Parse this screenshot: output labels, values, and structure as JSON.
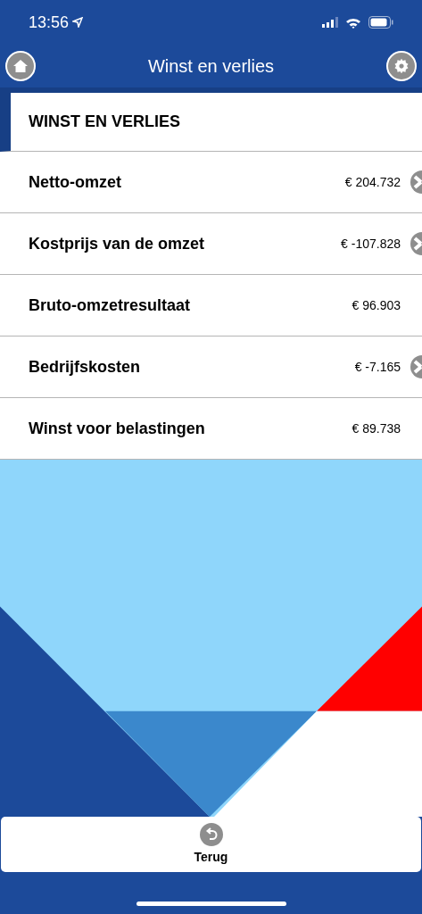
{
  "status_bar": {
    "time": "13:56"
  },
  "nav_bar": {
    "title": "Winst en verlies"
  },
  "section": {
    "title": "WINST EN VERLIES"
  },
  "rows": [
    {
      "label": "Netto-omzet",
      "value": "€ 204.732",
      "has_detail": true
    },
    {
      "label": "Kostprijs van de omzet",
      "value": "€ -107.828",
      "has_detail": true
    },
    {
      "label": "Bruto-omzetresultaat",
      "value": "€ 96.903",
      "has_detail": false
    },
    {
      "label": "Bedrijfskosten",
      "value": "€ -7.165",
      "has_detail": true
    },
    {
      "label": "Winst voor belastingen",
      "value": "€ 89.738",
      "has_detail": false
    }
  ],
  "footer": {
    "button": "Terug"
  }
}
